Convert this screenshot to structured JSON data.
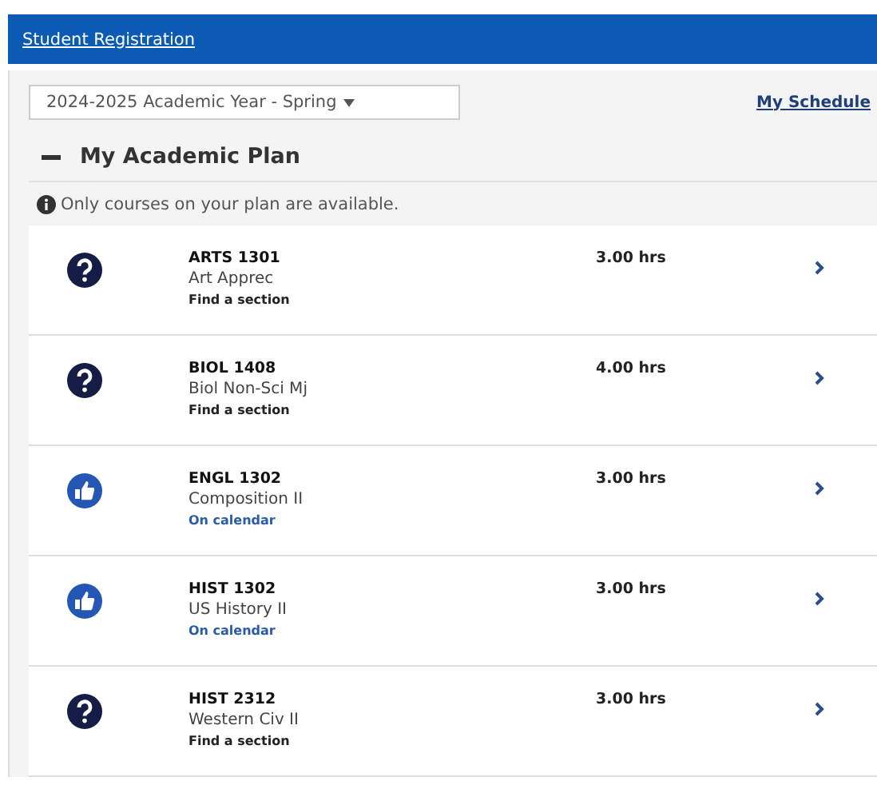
{
  "header": {
    "title": "Student Registration"
  },
  "term_select": {
    "value": "2024-2025 Academic Year - Spring"
  },
  "schedule_link": "My Schedule",
  "plan": {
    "title": "My Academic Plan",
    "expanded": true,
    "notice": "Only courses on your plan are available.",
    "courses": [
      {
        "kind": "question",
        "code": "ARTS 1301",
        "name": "Art Apprec",
        "action": "Find a section",
        "hours": "3.00 hrs"
      },
      {
        "kind": "question",
        "code": "BIOL 1408",
        "name": "Biol Non-Sci Mj",
        "action": "Find a section",
        "hours": "4.00 hrs"
      },
      {
        "kind": "thumbsup",
        "code": "ENGL 1302",
        "name": "Composition II",
        "action": "On calendar",
        "hours": "3.00 hrs"
      },
      {
        "kind": "thumbsup",
        "code": "HIST 1302",
        "name": "US History II",
        "action": "On calendar",
        "hours": "3.00 hrs"
      },
      {
        "kind": "question",
        "code": "HIST 2312",
        "name": "Western Civ II",
        "action": "Find a section",
        "hours": "3.00 hrs"
      }
    ]
  }
}
